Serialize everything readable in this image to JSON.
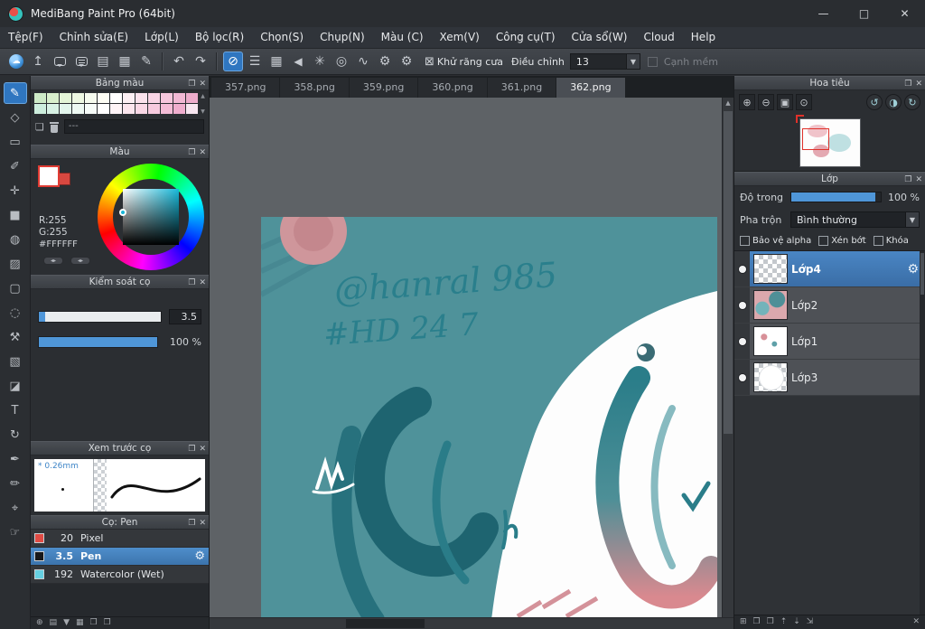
{
  "window": {
    "title": "MediBang Paint Pro (64bit)",
    "controls": {
      "minimize": "—",
      "maximize": "□",
      "close": "✕"
    }
  },
  "menu": {
    "items": [
      "Tệp(F)",
      "Chỉnh sửa(E)",
      "Lớp(L)",
      "Bộ lọc(R)",
      "Chọn(S)",
      "Chụp(N)",
      "Màu (C)",
      "Xem(V)",
      "Công cụ(T)",
      "Cửa sổ(W)",
      "Cloud",
      "Help"
    ]
  },
  "toolbar": {
    "icons": [
      {
        "name": "medibang-cloud",
        "glyph": "☁"
      },
      {
        "name": "upload",
        "glyph": "↥"
      },
      {
        "name": "comment",
        "glyph": ""
      },
      {
        "name": "chat",
        "glyph": ""
      },
      {
        "name": "document",
        "glyph": "▤"
      },
      {
        "name": "document-grid",
        "glyph": "▦"
      },
      {
        "name": "document-edit",
        "glyph": "✎"
      },
      {
        "name": "undo",
        "glyph": "↶"
      },
      {
        "name": "redo",
        "glyph": "↷"
      },
      {
        "name": "brush-shape",
        "glyph": "⊘"
      },
      {
        "name": "gradient-lines",
        "glyph": "☰"
      },
      {
        "name": "screentone",
        "glyph": "▦"
      },
      {
        "name": "triangle",
        "glyph": "◀"
      },
      {
        "name": "snap",
        "glyph": "✳"
      },
      {
        "name": "concentric",
        "glyph": "◎"
      },
      {
        "name": "curve",
        "glyph": "∿"
      },
      {
        "name": "snap-settings",
        "glyph": "⚙"
      },
      {
        "name": "settings",
        "glyph": "⚙"
      }
    ],
    "antialias_icon": "⊠",
    "antialias_label": "Khử răng cưa",
    "adjust_label": "Điều chỉnh",
    "adjust_value": "13",
    "dropdown_caret": "▼",
    "soft_edge_label": "Cạnh mềm"
  },
  "tool_strip": {
    "tools": [
      {
        "name": "brush",
        "glyph": "✎",
        "selected": true
      },
      {
        "name": "eraser",
        "glyph": "◇"
      },
      {
        "name": "select-rect",
        "glyph": "▭"
      },
      {
        "name": "draw",
        "glyph": "✐"
      },
      {
        "name": "move",
        "glyph": "✛"
      },
      {
        "name": "fill-rect",
        "glyph": "■"
      },
      {
        "name": "bucket",
        "glyph": "◍"
      },
      {
        "name": "gradient",
        "glyph": "▨"
      },
      {
        "name": "select",
        "glyph": "▢"
      },
      {
        "name": "lasso",
        "glyph": "◌"
      },
      {
        "name": "wand",
        "glyph": "⚒"
      },
      {
        "name": "select-pen",
        "glyph": "▧"
      },
      {
        "name": "select-eraser",
        "glyph": "◪"
      },
      {
        "name": "text",
        "glyph": "T"
      },
      {
        "name": "rotate",
        "glyph": "↻"
      },
      {
        "name": "pen",
        "glyph": "✒"
      },
      {
        "name": "pencil",
        "glyph": "✏"
      },
      {
        "name": "eyedropper",
        "glyph": "⌖"
      },
      {
        "name": "hand",
        "glyph": "☞"
      }
    ]
  },
  "tabs": {
    "items": [
      "357.png",
      "358.png",
      "359.png",
      "360.png",
      "361.png",
      "362.png"
    ],
    "active": "362.png"
  },
  "canvas": {
    "signature_line1": "@hanral 985",
    "signature_line2": "#HD 24 7"
  },
  "palette_panel": {
    "title": "Bảng màu",
    "field": "---",
    "swatches": [
      "#cdeac6",
      "#d8efcc",
      "#e3f4d6",
      "#eef8e2",
      "#f6fbee",
      "#fdfdf4",
      "#ffffff",
      "#fdf0f4",
      "#fbe2ec",
      "#f9d4e4",
      "#f6c6dc",
      "#f2b8d4",
      "#eeaccb",
      "#cdeedd",
      "#d8f2e5",
      "#e3f6ec",
      "#eef9f3",
      "#f7fcf9",
      "#ffffff",
      "#fef4f7",
      "#fce6ee",
      "#fad8e6",
      "#f7cade",
      "#f4bcd6",
      "#f0aece",
      "#f8e6f0"
    ]
  },
  "color_panel": {
    "title": "Màu",
    "r": "R:255",
    "g": "G:255",
    "hex": "#FFFFFF"
  },
  "brush_control_panel": {
    "title": "Kiểm soát cọ",
    "size_value": "3.5",
    "opacity_value": "100 %"
  },
  "brush_preview_panel": {
    "title": "Xem trước cọ",
    "size_label": "* 0.26mm"
  },
  "brush_list_panel": {
    "title": "Cọ: Pen",
    "brushes": [
      {
        "size": "20",
        "name": "Pixel",
        "color": "#e04b44"
      },
      {
        "size": "3.5",
        "name": "Pen",
        "color": "#17181a",
        "selected": true
      },
      {
        "size": "192",
        "name": "Watercolor (Wet)",
        "color": "#66d0e2"
      }
    ]
  },
  "left_bottom_icons": [
    {
      "name": "add-brush",
      "glyph": "⊕"
    },
    {
      "name": "brush-file",
      "glyph": "▤"
    },
    {
      "name": "brush-menu",
      "glyph": "▼"
    },
    {
      "name": "brush-grid",
      "glyph": "▦"
    },
    {
      "name": "brush-folder",
      "glyph": "❒"
    },
    {
      "name": "brush-copy",
      "glyph": "❐"
    }
  ],
  "navigator_panel": {
    "title": "Hoa tiêu",
    "icons": [
      {
        "name": "zoom-in",
        "glyph": "⊕"
      },
      {
        "name": "zoom-out",
        "glyph": "⊖"
      },
      {
        "name": "fit-window",
        "glyph": "▣"
      },
      {
        "name": "zoom-reset",
        "glyph": "⊙"
      },
      {
        "name": "rotate-left",
        "glyph": "↺"
      },
      {
        "name": "flip-horizontal",
        "glyph": "◑"
      },
      {
        "name": "rotate-right",
        "glyph": "↻"
      }
    ]
  },
  "layer_panel": {
    "title": "Lớp",
    "opacity_label": "Độ trong",
    "opacity_value": "100 %",
    "blend_label": "Pha trộn",
    "blend_value": "Bình thường",
    "checkboxes": [
      "Bảo vệ alpha",
      "Xén bớt",
      "Khóa"
    ],
    "layers": [
      {
        "name": "Lớp4",
        "selected": true
      },
      {
        "name": "Lớp2"
      },
      {
        "name": "Lớp1"
      },
      {
        "name": "Lớp3"
      }
    ],
    "bottom_icons": [
      {
        "name": "add-layer",
        "glyph": "⊞"
      },
      {
        "name": "duplicate-layer",
        "glyph": "❐"
      },
      {
        "name": "layer-folder",
        "glyph": "❒"
      },
      {
        "name": "move-layer-up",
        "glyph": "⇡"
      },
      {
        "name": "move-layer-down",
        "glyph": "⇣"
      },
      {
        "name": "merge-layer",
        "glyph": "⇲"
      },
      {
        "name": "delete-layer",
        "glyph": "✕"
      }
    ]
  }
}
